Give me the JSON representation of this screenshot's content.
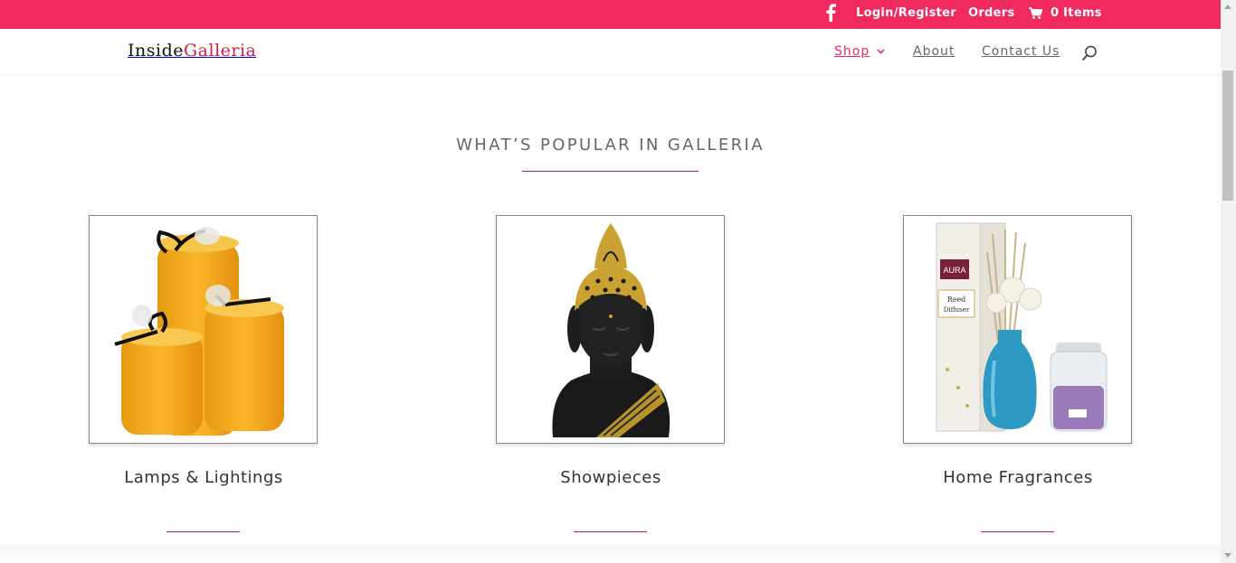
{
  "topbar": {
    "background": "#f0295e",
    "facebook_icon": "facebook-icon",
    "login_label": "Login/Register",
    "orders_label": "Orders",
    "cart_icon": "cart-icon",
    "cart_label": "0 Items"
  },
  "header": {
    "logo_part1": "Inside",
    "logo_part2": "Galleria",
    "nav": {
      "shop": "Shop",
      "about": "About",
      "contact": "Contact Us"
    },
    "search_icon": "search-icon",
    "accent": "#f0295e"
  },
  "main": {
    "section_title": "WHAT’S POPULAR IN GALLERIA",
    "products": [
      {
        "label": "Lamps & Lightings",
        "image": "candles-image"
      },
      {
        "label": "Showpieces",
        "image": "buddha-bust-image"
      },
      {
        "label": "Home Fragrances",
        "image": "reed-diffuser-image"
      }
    ]
  },
  "diffuser_box": {
    "brand": "AURA",
    "product": "Reed",
    "product_line2": "Diffuser"
  }
}
